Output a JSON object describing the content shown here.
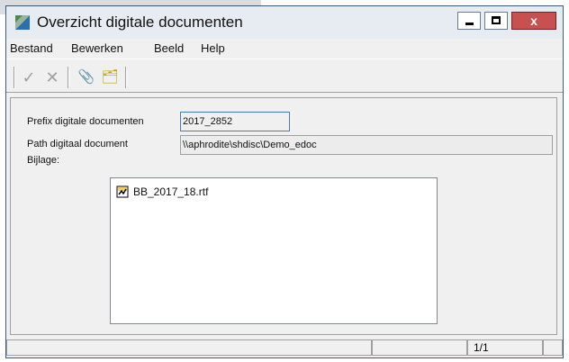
{
  "window": {
    "title": "Overzicht digitale documenten",
    "close_glyph": "x"
  },
  "menu": [
    "Bestand",
    "Bewerken",
    "Beeld",
    "Help"
  ],
  "toolbar": {
    "buttons": [
      {
        "icon": "checkmark-icon",
        "glyph": "✓",
        "color": "#a0a0a0"
      },
      {
        "icon": "cross-icon",
        "glyph": "✕",
        "color": "#a0a0a0"
      },
      {
        "icon": "paperclip-icon",
        "glyph": "📎",
        "color": "#333333"
      },
      {
        "icon": "folder-search-icon",
        "glyph": "🗂",
        "color": "#c8a020"
      }
    ]
  },
  "form": {
    "prefix_label": "Prefix digitale documenten",
    "prefix_value": "2017_2852",
    "path_label": "Path digitaal document",
    "path_value": "\\\\aphrodite\\shdisc\\Demo_edoc",
    "attachment_label": "Bijlage:"
  },
  "attachments": [
    {
      "icon": "rtf-document-icon",
      "name": "BB_2017_18.rtf"
    }
  ],
  "status": {
    "cell1": "",
    "cell2": "",
    "page": "1/1",
    "cell4": ""
  },
  "colors": {
    "close_button": "#c75050",
    "title_bar": "#e6ecf2",
    "window_border": "#3c5a78"
  }
}
